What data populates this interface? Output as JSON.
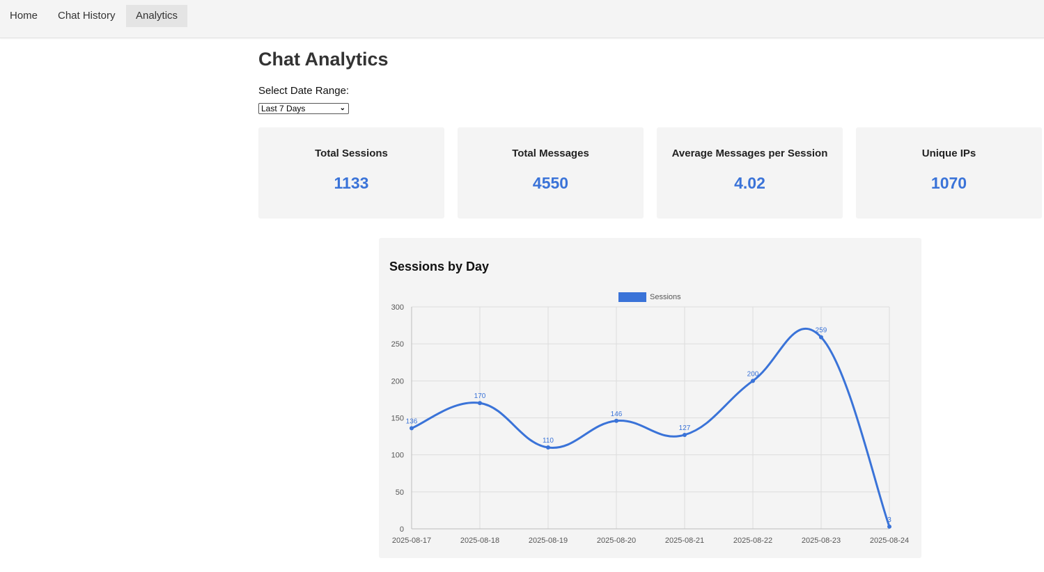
{
  "nav": {
    "home": "Home",
    "chat_history": "Chat History",
    "analytics": "Analytics"
  },
  "page": {
    "title": "Chat Analytics",
    "range_label": "Select Date Range:",
    "range_value": "Last 7 Days"
  },
  "stats": {
    "total_sessions": {
      "label": "Total Sessions",
      "value": "1133"
    },
    "total_messages": {
      "label": "Total Messages",
      "value": "4550"
    },
    "avg_messages": {
      "label": "Average Messages per Session",
      "value": "4.02"
    },
    "unique_ips": {
      "label": "Unique IPs",
      "value": "1070"
    }
  },
  "colors": {
    "accent": "#3a73d8",
    "panel": "#f4f4f4"
  },
  "chart_data": {
    "type": "line",
    "title": "Sessions by Day",
    "x": [
      "2025-08-17",
      "2025-08-18",
      "2025-08-19",
      "2025-08-20",
      "2025-08-21",
      "2025-08-22",
      "2025-08-23",
      "2025-08-24"
    ],
    "series": [
      {
        "name": "Sessions",
        "values": [
          136,
          170,
          110,
          146,
          127,
          200,
          259,
          3
        ],
        "color": "#3a73d8"
      }
    ],
    "ylim": [
      0,
      300
    ],
    "yticks": [
      0,
      50,
      100,
      150,
      200,
      250,
      300
    ],
    "xlabel": "",
    "ylabel": "",
    "grid": true,
    "legend": "top-center",
    "data_labels": true
  }
}
